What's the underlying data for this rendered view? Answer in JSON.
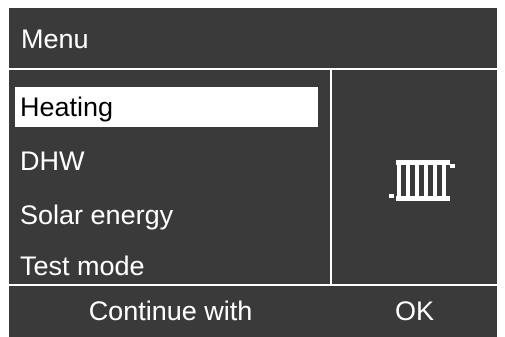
{
  "header": {
    "title": "Menu"
  },
  "menu": {
    "items": [
      {
        "label": "Heating",
        "selected": true
      },
      {
        "label": "DHW",
        "selected": false
      },
      {
        "label": "Solar energy",
        "selected": false
      },
      {
        "label": "Test mode",
        "selected": false
      }
    ]
  },
  "preview": {
    "icon": "radiator-icon"
  },
  "footer": {
    "left_label": "Continue with",
    "right_label": "OK"
  },
  "colors": {
    "background": "#3a3a3a",
    "foreground": "#ffffff",
    "selection": "#ffffff",
    "selection_text": "#000000"
  }
}
